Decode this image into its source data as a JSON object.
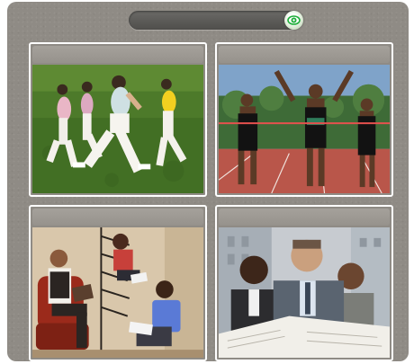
{
  "toolbar": {
    "progress_label": "",
    "toggle_icon": "eye-icon"
  },
  "colors": {
    "panel": "#8f8b85",
    "track": "#5a5956",
    "toggle_accent": "#1fae3a",
    "tile_border": "#ffffff"
  },
  "tiles": [
    {
      "label": "",
      "image": "women-running-on-grass-photo"
    },
    {
      "label": "",
      "image": "sprinters-crossing-finish-line-photo"
    },
    {
      "label": "",
      "image": "women-reading-books-photo"
    },
    {
      "label": "",
      "image": "businessmen-reading-newspaper-photo"
    }
  ]
}
